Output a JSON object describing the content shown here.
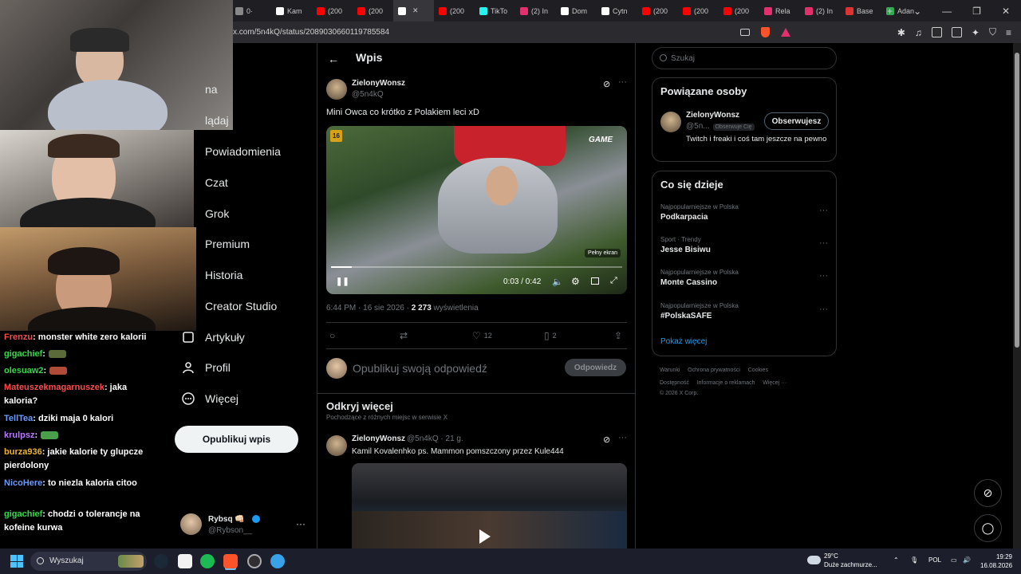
{
  "browser": {
    "tabs": [
      {
        "label": "0·",
        "color": "#888"
      },
      {
        "label": "Kam",
        "color": "#ffffff"
      },
      {
        "label": "(200",
        "color": "#ff0000"
      },
      {
        "label": "(200",
        "color": "#ff0000"
      },
      {
        "label": "",
        "color": "#ffffff",
        "active": true
      },
      {
        "label": "(200",
        "color": "#ff0000"
      },
      {
        "label": "TikTo",
        "color": "#25f4ee"
      },
      {
        "label": "(2) In",
        "color": "#e1306c"
      },
      {
        "label": "Dom",
        "color": "#ffffff"
      },
      {
        "label": "Cytn",
        "color": "#ffffff"
      },
      {
        "label": "(200",
        "color": "#ff0000"
      },
      {
        "label": "(200",
        "color": "#ff0000"
      },
      {
        "label": "(200",
        "color": "#ff0000"
      },
      {
        "label": "Rela",
        "color": "#e1306c"
      },
      {
        "label": "(2) In",
        "color": "#e1306c"
      },
      {
        "label": "Base",
        "color": "#d33"
      },
      {
        "label": "Adan",
        "color": "#34a853"
      }
    ],
    "new_tab": "+",
    "url": "x.com/5n4kQ/status/2089030660119785584"
  },
  "nav": {
    "items": [
      {
        "label": "na",
        "name": "nav-item-home"
      },
      {
        "label": "lądaj",
        "name": "nav-item-explore"
      },
      {
        "label": "Powiadomienia",
        "name": "nav-item-notifications"
      },
      {
        "label": "Czat",
        "name": "nav-item-chat"
      },
      {
        "label": "Grok",
        "name": "nav-item-grok"
      },
      {
        "label": "Premium",
        "name": "nav-item-premium"
      },
      {
        "label": "Historia",
        "name": "nav-item-history"
      },
      {
        "label": "Creator Studio",
        "name": "nav-item-creator-studio"
      },
      {
        "label": "Artykuły",
        "name": "nav-item-articles"
      },
      {
        "label": "Profil",
        "name": "nav-item-profile"
      },
      {
        "label": "Więcej",
        "name": "nav-item-more"
      }
    ],
    "post_button": "Opublikuj wpis",
    "account": {
      "name": "Rybsq 👊🏻",
      "handle": "@Rybson__",
      "more": "···"
    }
  },
  "chat": [
    {
      "user": "Frenzu",
      "color": "#ff4a4a",
      "text": ": monster white zero kalorii"
    },
    {
      "user": "gigachief",
      "color": "#36d64a",
      "text": ":"
    },
    {
      "user": "olesuaw2",
      "color": "#36d64a",
      "text": ":"
    },
    {
      "user": "Mateuszekmagarnuszek",
      "color": "#ff4a4a",
      "text": ": jaka kaloria?"
    },
    {
      "user": "TellTea",
      "color": "#6b9bff",
      "text": ": dziki maja 0 kalori"
    },
    {
      "user": "krulpsz",
      "color": "#b97cff",
      "text": ":"
    },
    {
      "user": "burza936",
      "color": "#f0b429",
      "text": ": jakie kalorie ty glupcze pierdolony"
    },
    {
      "user": "NicoHere",
      "color": "#6b9bff",
      "text": ": to niezla kaloria citoo"
    },
    {
      "user": "gigachief",
      "color": "#36d64a",
      "text": ": chodzi o tolerancje na kofeine kurwa"
    }
  ],
  "main": {
    "back": "←",
    "title": "Wpis",
    "tweet": {
      "author": "ZielonyWonsz",
      "handle": "@5n4kQ",
      "text": "Mini Owca co krótko z Polakiem leci xD",
      "video": {
        "age_rating": "16",
        "watermark": "GAME",
        "tooltip": "Pełny ekran",
        "time": "0:03 / 0:42",
        "progress": 0.07
      },
      "timestamp": "6:44 PM · 16 sie 2026 · ",
      "views": "2 273",
      "views_label": " wyświetlenia",
      "likes": "12",
      "bookmarks": "2"
    },
    "reply": {
      "placeholder": "Opublikuj swoją odpowiedź",
      "button": "Odpowiedz"
    },
    "discover": {
      "title": "Odkryj więcej",
      "subtitle": "Pochodzące z różnych miejsc w serwisie X",
      "tweet": {
        "author": "ZielonyWonsz",
        "handle": "@5n4kQ · 21 g.",
        "text": "Kamil Kovalenhko ps. Mammon pomszczony przez Kule444"
      }
    }
  },
  "right": {
    "search_placeholder": "Szukaj",
    "related": {
      "title": "Powiązane osoby",
      "user": {
        "name": "ZielonyWonsz",
        "handle": "@5n...",
        "follows_you": "Obserwuje Cię",
        "bio": "Twitch i freaki i coś tam jeszcze na pewno"
      },
      "follow_button": "Obserwujesz"
    },
    "trends": {
      "title": "Co się dzieje",
      "items": [
        {
          "category": "Najpopularniejsze w Polska",
          "topic": "Podkarpacia"
        },
        {
          "category": "Sport · Trendy",
          "topic": "Jesse Bisiwu"
        },
        {
          "category": "Najpopularniejsze w Polska",
          "topic": "Monte Cassino"
        },
        {
          "category": "Najpopularniejsze w Polska",
          "topic": "#PolskaSAFE"
        }
      ],
      "show_more": "Pokaż więcej"
    },
    "footer": {
      "line1": [
        "Warunki",
        "Ochrona prywatności",
        "Cookies"
      ],
      "line2": [
        "Dostępność",
        "Informacje o reklamach",
        "Więcej ···"
      ],
      "copyright": "© 2026 X Corp."
    }
  },
  "taskbar": {
    "search_placeholder": "Wyszukaj",
    "weather_temp": "29°C",
    "weather_desc": "Duże zachmurze...",
    "lang": "POL",
    "time": "19:29",
    "date": "16.08.2026"
  }
}
